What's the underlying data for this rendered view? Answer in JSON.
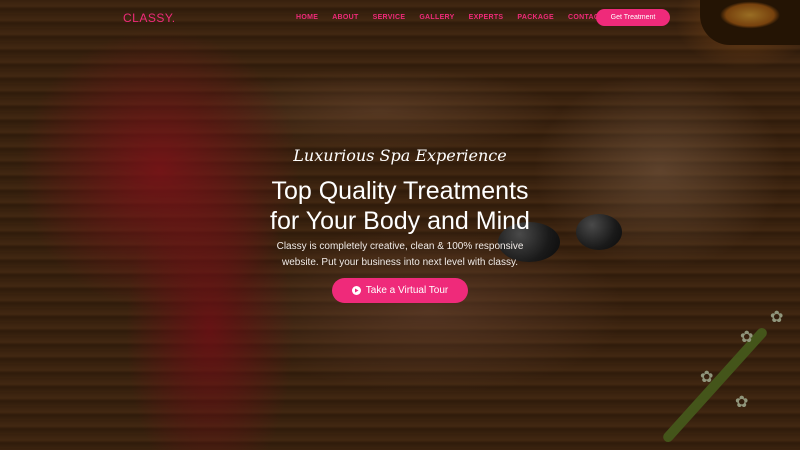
{
  "brand": {
    "logo": "CLASSY."
  },
  "nav": {
    "items": [
      "HOME",
      "ABOUT",
      "SERVICE",
      "GALLERY",
      "EXPERTS",
      "PACKAGE",
      "CONTACT"
    ],
    "cta_label": "Get Treatment"
  },
  "hero": {
    "subtitle": "Luxurious Spa Experience",
    "title_line1": "Top Quality Treatments",
    "title_line2": "for Your Body and Mind",
    "description_line1": "Classy is completely creative, clean & 100% responsive",
    "description_line2": "website. Put your business into next level with classy.",
    "button_label": "Take a Virtual Tour",
    "button_icon": "play-circle-icon"
  },
  "colors": {
    "accent": "#ef2a7a",
    "text": "#ffffff"
  }
}
